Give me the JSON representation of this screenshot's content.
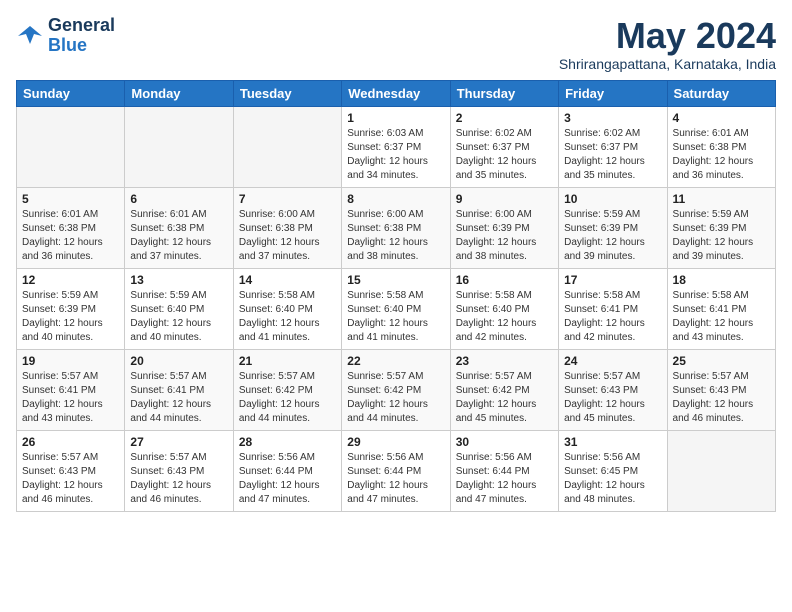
{
  "header": {
    "logo_line1": "General",
    "logo_line2": "Blue",
    "month": "May 2024",
    "location": "Shrirangapattana, Karnataka, India"
  },
  "days_of_week": [
    "Sunday",
    "Monday",
    "Tuesday",
    "Wednesday",
    "Thursday",
    "Friday",
    "Saturday"
  ],
  "weeks": [
    [
      {
        "day": "",
        "info": ""
      },
      {
        "day": "",
        "info": ""
      },
      {
        "day": "",
        "info": ""
      },
      {
        "day": "1",
        "info": "Sunrise: 6:03 AM\nSunset: 6:37 PM\nDaylight: 12 hours\nand 34 minutes."
      },
      {
        "day": "2",
        "info": "Sunrise: 6:02 AM\nSunset: 6:37 PM\nDaylight: 12 hours\nand 35 minutes."
      },
      {
        "day": "3",
        "info": "Sunrise: 6:02 AM\nSunset: 6:37 PM\nDaylight: 12 hours\nand 35 minutes."
      },
      {
        "day": "4",
        "info": "Sunrise: 6:01 AM\nSunset: 6:38 PM\nDaylight: 12 hours\nand 36 minutes."
      }
    ],
    [
      {
        "day": "5",
        "info": "Sunrise: 6:01 AM\nSunset: 6:38 PM\nDaylight: 12 hours\nand 36 minutes."
      },
      {
        "day": "6",
        "info": "Sunrise: 6:01 AM\nSunset: 6:38 PM\nDaylight: 12 hours\nand 37 minutes."
      },
      {
        "day": "7",
        "info": "Sunrise: 6:00 AM\nSunset: 6:38 PM\nDaylight: 12 hours\nand 37 minutes."
      },
      {
        "day": "8",
        "info": "Sunrise: 6:00 AM\nSunset: 6:38 PM\nDaylight: 12 hours\nand 38 minutes."
      },
      {
        "day": "9",
        "info": "Sunrise: 6:00 AM\nSunset: 6:39 PM\nDaylight: 12 hours\nand 38 minutes."
      },
      {
        "day": "10",
        "info": "Sunrise: 5:59 AM\nSunset: 6:39 PM\nDaylight: 12 hours\nand 39 minutes."
      },
      {
        "day": "11",
        "info": "Sunrise: 5:59 AM\nSunset: 6:39 PM\nDaylight: 12 hours\nand 39 minutes."
      }
    ],
    [
      {
        "day": "12",
        "info": "Sunrise: 5:59 AM\nSunset: 6:39 PM\nDaylight: 12 hours\nand 40 minutes."
      },
      {
        "day": "13",
        "info": "Sunrise: 5:59 AM\nSunset: 6:40 PM\nDaylight: 12 hours\nand 40 minutes."
      },
      {
        "day": "14",
        "info": "Sunrise: 5:58 AM\nSunset: 6:40 PM\nDaylight: 12 hours\nand 41 minutes."
      },
      {
        "day": "15",
        "info": "Sunrise: 5:58 AM\nSunset: 6:40 PM\nDaylight: 12 hours\nand 41 minutes."
      },
      {
        "day": "16",
        "info": "Sunrise: 5:58 AM\nSunset: 6:40 PM\nDaylight: 12 hours\nand 42 minutes."
      },
      {
        "day": "17",
        "info": "Sunrise: 5:58 AM\nSunset: 6:41 PM\nDaylight: 12 hours\nand 42 minutes."
      },
      {
        "day": "18",
        "info": "Sunrise: 5:58 AM\nSunset: 6:41 PM\nDaylight: 12 hours\nand 43 minutes."
      }
    ],
    [
      {
        "day": "19",
        "info": "Sunrise: 5:57 AM\nSunset: 6:41 PM\nDaylight: 12 hours\nand 43 minutes."
      },
      {
        "day": "20",
        "info": "Sunrise: 5:57 AM\nSunset: 6:41 PM\nDaylight: 12 hours\nand 44 minutes."
      },
      {
        "day": "21",
        "info": "Sunrise: 5:57 AM\nSunset: 6:42 PM\nDaylight: 12 hours\nand 44 minutes."
      },
      {
        "day": "22",
        "info": "Sunrise: 5:57 AM\nSunset: 6:42 PM\nDaylight: 12 hours\nand 44 minutes."
      },
      {
        "day": "23",
        "info": "Sunrise: 5:57 AM\nSunset: 6:42 PM\nDaylight: 12 hours\nand 45 minutes."
      },
      {
        "day": "24",
        "info": "Sunrise: 5:57 AM\nSunset: 6:43 PM\nDaylight: 12 hours\nand 45 minutes."
      },
      {
        "day": "25",
        "info": "Sunrise: 5:57 AM\nSunset: 6:43 PM\nDaylight: 12 hours\nand 46 minutes."
      }
    ],
    [
      {
        "day": "26",
        "info": "Sunrise: 5:57 AM\nSunset: 6:43 PM\nDaylight: 12 hours\nand 46 minutes."
      },
      {
        "day": "27",
        "info": "Sunrise: 5:57 AM\nSunset: 6:43 PM\nDaylight: 12 hours\nand 46 minutes."
      },
      {
        "day": "28",
        "info": "Sunrise: 5:56 AM\nSunset: 6:44 PM\nDaylight: 12 hours\nand 47 minutes."
      },
      {
        "day": "29",
        "info": "Sunrise: 5:56 AM\nSunset: 6:44 PM\nDaylight: 12 hours\nand 47 minutes."
      },
      {
        "day": "30",
        "info": "Sunrise: 5:56 AM\nSunset: 6:44 PM\nDaylight: 12 hours\nand 47 minutes."
      },
      {
        "day": "31",
        "info": "Sunrise: 5:56 AM\nSunset: 6:45 PM\nDaylight: 12 hours\nand 48 minutes."
      },
      {
        "day": "",
        "info": ""
      }
    ]
  ]
}
